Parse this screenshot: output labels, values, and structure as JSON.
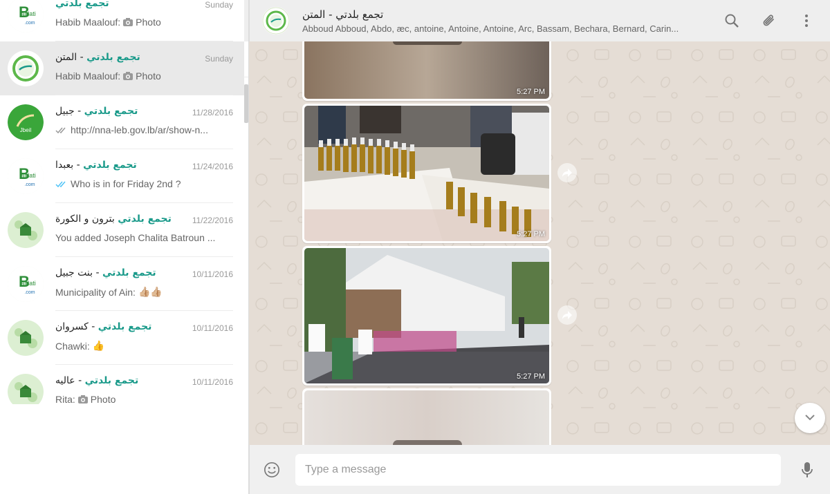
{
  "sidebar": {
    "search": {
      "value": "تجمع بلدتي",
      "placeholder": ""
    },
    "chats": [
      {
        "brand": "تجمع بلدتي",
        "suffix": "",
        "date": "Sunday",
        "sender": "Habib Maalouf:",
        "preview": "Photo",
        "preview_kind": "photo",
        "avatar": "baldati-com"
      },
      {
        "brand": "تجمع بلدتي",
        "suffix": " - المتن",
        "date": "Sunday",
        "sender": "Habib Maalouf:",
        "preview": "Photo",
        "preview_kind": "photo",
        "avatar": "baldati-circle",
        "active": true
      },
      {
        "brand": "تجمع بلدتي",
        "suffix": " - جبيل",
        "date": "11/28/2016",
        "sender": "",
        "preview": "http://nna-leb.gov.lb/ar/show-n...",
        "preview_kind": "ticks-gray",
        "avatar": "jbeil-trails"
      },
      {
        "brand": "تجمع بلدتي",
        "suffix": " - بعبدا",
        "date": "11/24/2016",
        "sender": "",
        "preview": "Who is in for Friday 2nd ?",
        "preview_kind": "ticks-blue",
        "avatar": "baldati-com"
      },
      {
        "brand": "تجمع بلدتي",
        "suffix": " بترون و الكورة",
        "date": "11/22/2016",
        "sender": "",
        "preview": "You added Joseph Chalita Batroun ...",
        "preview_kind": "text",
        "avatar": "baldati-green"
      },
      {
        "brand": "تجمع بلدتي",
        "suffix": " - بنت جبيل",
        "date": "10/11/2016",
        "sender": "Municipality of Ain:",
        "preview": "👍🏼👍🏼",
        "preview_kind": "text",
        "avatar": "baldati-com"
      },
      {
        "brand": "تجمع بلدتي",
        "suffix": " - كسروان",
        "date": "10/11/2016",
        "sender": "Chawki:",
        "preview": "👍",
        "preview_kind": "text",
        "avatar": "baldati-green"
      },
      {
        "brand": "تجمع بلدتي",
        "suffix": " - عاليه",
        "date": "10/11/2016",
        "sender": "Rita:",
        "preview": "Photo",
        "preview_kind": "photo",
        "avatar": "baldati-green"
      }
    ]
  },
  "conversation": {
    "title": "تجمع بلدتي - المتن",
    "members": "Abboud Abboud, Abdo, æc, antoine, Antoine, Antoine, Arc, Bassam, Bechara, Bernard, Carin...",
    "messages": [
      {
        "time": "5:27 PM",
        "kind": "blurred"
      },
      {
        "time": "5:27 PM",
        "kind": "bottles"
      },
      {
        "time": "5:27 PM",
        "kind": "tent"
      },
      {
        "time": "",
        "kind": "blurred"
      }
    ]
  },
  "composer": {
    "placeholder": "Type a message"
  },
  "colors": {
    "brand": "#1a9a8a",
    "header_bg": "#eeeeee",
    "chat_bg": "#e5ddd5",
    "accent_blue": "#4fc3f7"
  },
  "icons": [
    "new-chat-icon",
    "menu-icon",
    "back-arrow-icon",
    "close-icon",
    "search-icon",
    "attach-icon",
    "emoji-icon",
    "mic-icon",
    "forward-icon",
    "chevron-down-icon",
    "camera-icon"
  ]
}
